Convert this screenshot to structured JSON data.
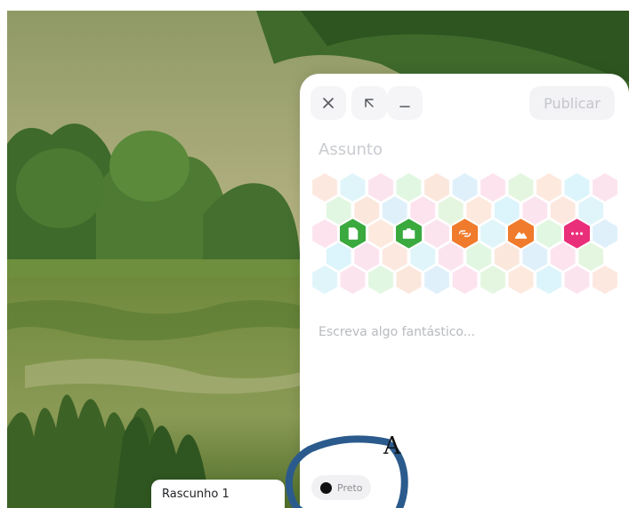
{
  "composer": {
    "close_icon": "close-icon",
    "expand_icon": "expand-arrow-icon",
    "minimize_icon": "minimize-icon",
    "publish_label": "Publicar",
    "subject_placeholder": "Assunto",
    "body_placeholder": "Escreva algo fantástico...",
    "attachments": [
      {
        "name": "file-icon",
        "color": "#3aaa3f"
      },
      {
        "name": "camera-icon",
        "color": "#3aaa3f"
      },
      {
        "name": "link-icon",
        "color": "#f07b2c"
      },
      {
        "name": "image-gallery-icon",
        "color": "#f07b2c"
      },
      {
        "name": "more-icon",
        "color": "#ea2f7a"
      }
    ]
  },
  "color_picker": {
    "label": "Preto",
    "swatch": "#111111"
  },
  "draft_tab": {
    "label": "Rascunho 1"
  },
  "annotation": {
    "letter": "A",
    "ring_color": "#2b5a8c"
  }
}
